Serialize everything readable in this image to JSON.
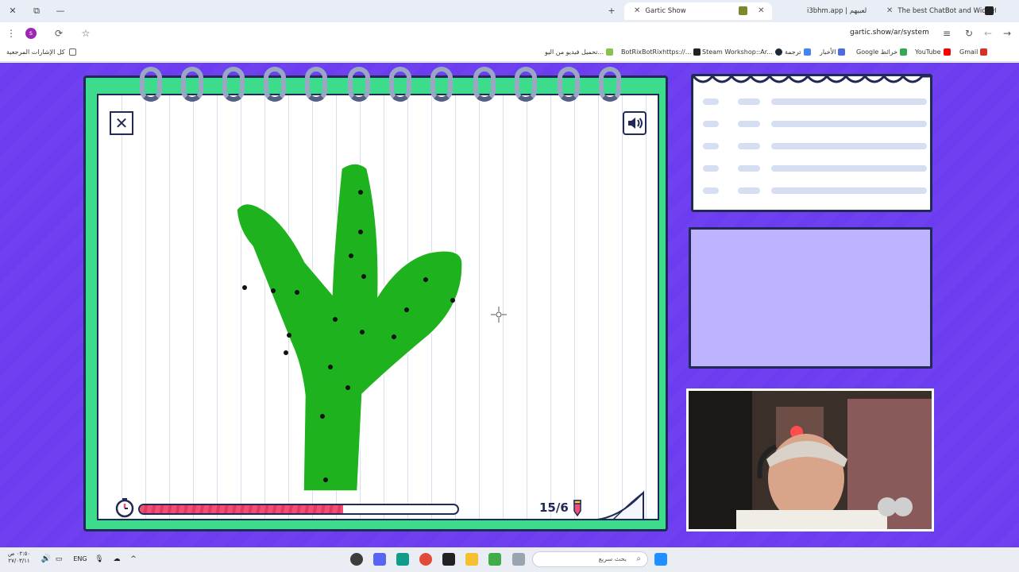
{
  "browser": {
    "tabs": [
      {
        "label": "Gartic Show",
        "active": true
      },
      {
        "label": "i3bhm.app | لعبيهم",
        "active": false
      },
      {
        "label": "The best ChatBot and Widgets",
        "active": false
      }
    ],
    "url": "gartic.show/ar/system",
    "profile_initial": "s",
    "bookmarks": [
      "Gmail",
      "YouTube",
      "Google خرائط",
      "الأخبار",
      "ترجمة",
      "Steam Workshop::Ar...",
      "BotRixBotRixhttps://...",
      "تحميل فيديو من اليو..."
    ],
    "all_bookmarks": "كل الإشارات المرجعية"
  },
  "game": {
    "round": "15/6",
    "timer_progress": 0.64,
    "accent_color": "#3ddb8c",
    "background_color": "#6c3cf0",
    "timer_color": "#ef4f74"
  },
  "taskbar": {
    "language": "ENG",
    "time": "٠٢:٥٠ ص",
    "date": "٢٧/٠٣/١١",
    "search_placeholder": "بحث سريع"
  }
}
